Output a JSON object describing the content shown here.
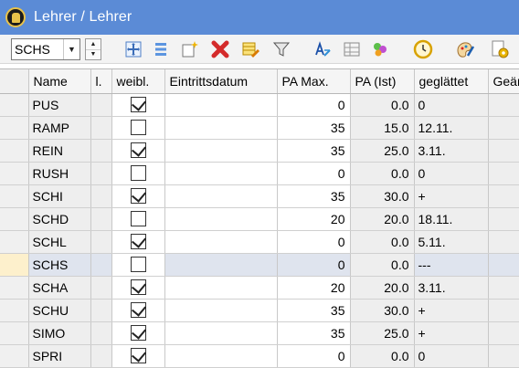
{
  "window": {
    "title": "Lehrer / Lehrer"
  },
  "toolbar": {
    "selected_teacher": "SCHS",
    "icons": [
      "tree-view-icon",
      "list-view-icon",
      "new-record-icon",
      "delete-icon",
      "table-edit-icon",
      "filter-icon",
      "sort-icon",
      "grid-settings-icon",
      "colors-icon",
      "clock-icon",
      "palette-tools-icon",
      "document-settings-icon"
    ]
  },
  "table": {
    "columns": [
      "Name",
      "l.",
      "weibl.",
      "Eintrittsdatum",
      "PA Max.",
      "PA (Ist)",
      "geglättet",
      "Geän"
    ],
    "rows": [
      {
        "name": "PUS",
        "weibl": true,
        "pa_max": "0",
        "pa_ist": "0.0",
        "geglaettet": "0"
      },
      {
        "name": "RAMP",
        "weibl": false,
        "pa_max": "35",
        "pa_ist": "15.0",
        "geglaettet": "12.11."
      },
      {
        "name": "REIN",
        "weibl": true,
        "pa_max": "35",
        "pa_ist": "25.0",
        "geglaettet": "3.11."
      },
      {
        "name": "RUSH",
        "weibl": false,
        "pa_max": "0",
        "pa_ist": "0.0",
        "geglaettet": "0"
      },
      {
        "name": "SCHI",
        "weibl": true,
        "pa_max": "35",
        "pa_ist": "30.0",
        "geglaettet": "+"
      },
      {
        "name": "SCHD",
        "weibl": false,
        "pa_max": "20",
        "pa_ist": "20.0",
        "geglaettet": "18.11."
      },
      {
        "name": "SCHL",
        "weibl": true,
        "pa_max": "0",
        "pa_ist": "0.0",
        "geglaettet": "5.11."
      },
      {
        "name": "SCHS",
        "weibl": false,
        "pa_max": "0",
        "pa_ist": "0.0",
        "geglaettet": "---",
        "selected": true
      },
      {
        "name": "SCHA",
        "weibl": true,
        "pa_max": "20",
        "pa_ist": "20.0",
        "geglaettet": "3.11."
      },
      {
        "name": "SCHU",
        "weibl": true,
        "pa_max": "35",
        "pa_ist": "30.0",
        "geglaettet": "+"
      },
      {
        "name": "SIMO",
        "weibl": true,
        "pa_max": "35",
        "pa_ist": "25.0",
        "geglaettet": "+"
      },
      {
        "name": "SPRI",
        "weibl": true,
        "pa_max": "0",
        "pa_ist": "0.0",
        "geglaettet": "0"
      }
    ]
  }
}
